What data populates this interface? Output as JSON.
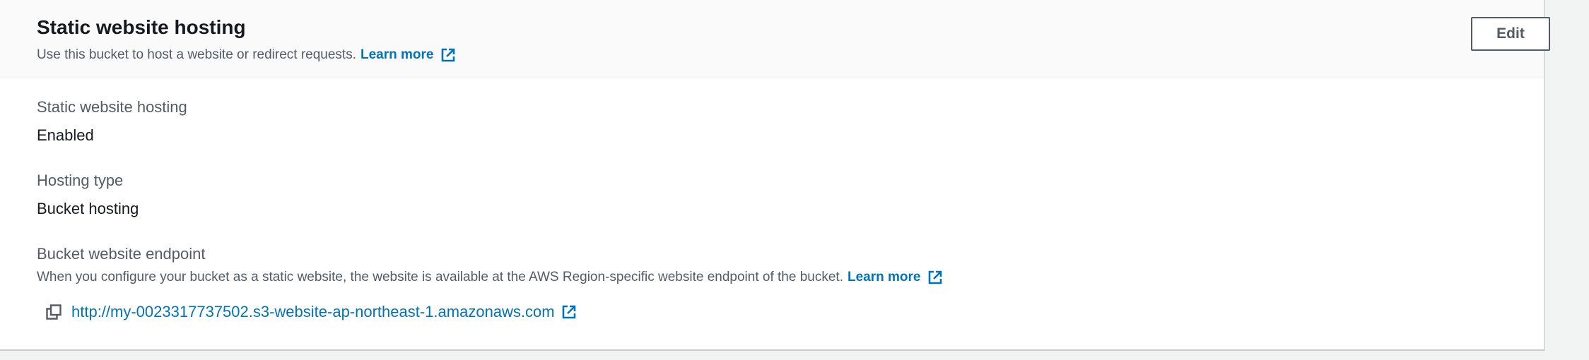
{
  "header": {
    "title": "Static website hosting",
    "description": "Use this bucket to host a website or redirect requests.",
    "learn_more": "Learn more",
    "edit_label": "Edit"
  },
  "fields": {
    "hosting": {
      "label": "Static website hosting",
      "value": "Enabled"
    },
    "hosting_type": {
      "label": "Hosting type",
      "value": "Bucket hosting"
    },
    "endpoint": {
      "label": "Bucket website endpoint",
      "description": "When you configure your bucket as a static website, the website is available at the AWS Region-specific website endpoint of the bucket.",
      "learn_more": "Learn more",
      "url": "http://my-0023317737502.s3-website-ap-northeast-1.amazonaws.com"
    }
  },
  "icons": {
    "external_link": "external-link-icon",
    "copy": "copy-icon"
  },
  "colors": {
    "link": "#0073bb",
    "title": "#16191f",
    "secondary_text": "#545b64",
    "header_bg": "#fafafa",
    "page_bg": "#f2f3f3"
  }
}
